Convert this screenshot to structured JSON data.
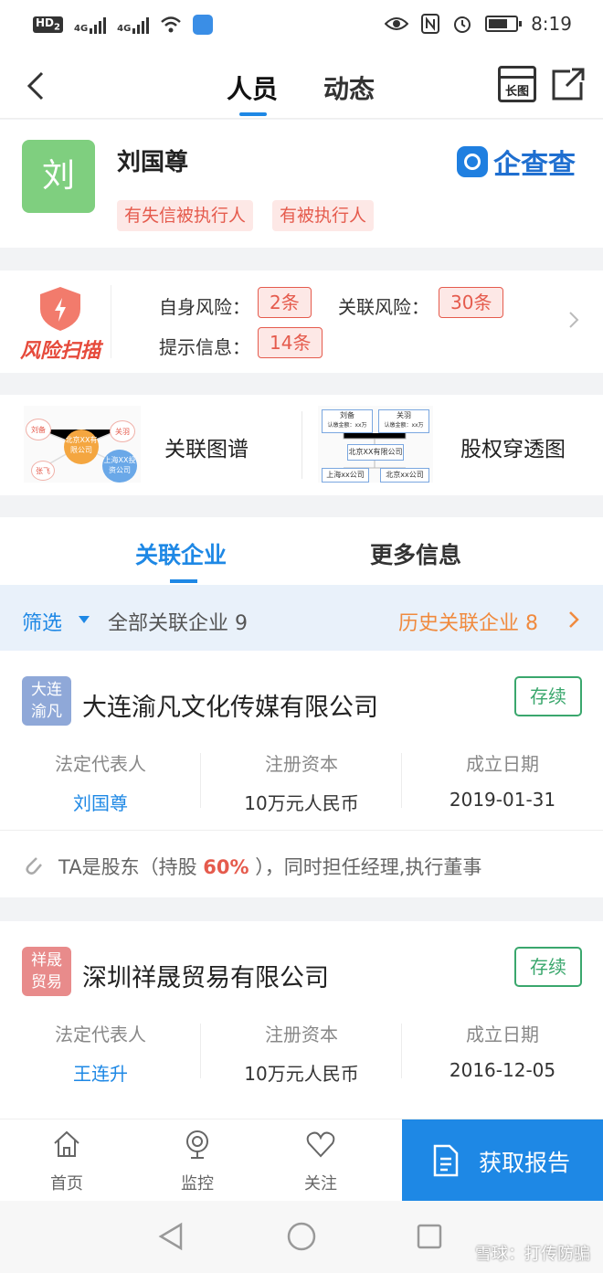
{
  "status_bar": {
    "hd": "HD",
    "hd_sub": "2",
    "net1": "4G",
    "net2": "4G",
    "time": "8:19"
  },
  "header": {
    "tabs": [
      "人员",
      "动态"
    ],
    "long_image": "长图"
  },
  "person": {
    "avatar_char": "刘",
    "name": "刘国尊",
    "tags": [
      "有失信被执行人",
      "有被执行人"
    ],
    "brand": "企查查"
  },
  "risk": {
    "icon_label": "风险扫描",
    "items": [
      {
        "label": "自身风险：",
        "value": "2条"
      },
      {
        "label": "关联风险：",
        "value": "30条"
      },
      {
        "label": "提示信息：",
        "value": "14条"
      }
    ]
  },
  "graphs": {
    "relation": {
      "label": "关联图谱",
      "nodes": [
        "刘备",
        "关羽",
        "张飞",
        "北京XX有限公司",
        "上海XX投资公司"
      ]
    },
    "equity": {
      "label": "股权穿透图",
      "boxes": [
        "刘备",
        "认缴金额：xx万",
        "关羽",
        "认缴金额：xx万",
        "北京XX有限公司",
        "上海xx公司",
        "北京xx公司"
      ]
    }
  },
  "section_tabs": [
    "关联企业",
    "更多信息"
  ],
  "filter": {
    "select": "筛选",
    "all": "全部关联企业 9",
    "history": "历史关联企业 8"
  },
  "companies": [
    {
      "badge": [
        "大连",
        "渝凡"
      ],
      "badge_color": "#8fa8d8",
      "name": "大连渝凡文化传媒有限公司",
      "status": "存续",
      "cols": [
        {
          "label": "法定代表人",
          "value": "刘国尊"
        },
        {
          "label": "注册资本",
          "value": "10万元人民币"
        },
        {
          "label": "成立日期",
          "value": "2019-01-31"
        }
      ],
      "foot": {
        "pre": "TA是股东（持股 ",
        "pct": "60%",
        "post": " ），同时担任经理,执行董事"
      }
    },
    {
      "badge": [
        "祥晟",
        "贸易"
      ],
      "badge_color": "#e88b8b",
      "name": "深圳祥晟贸易有限公司",
      "status": "存续",
      "cols": [
        {
          "label": "法定代表人",
          "value": "王连升"
        },
        {
          "label": "注册资本",
          "value": "10万元人民币"
        },
        {
          "label": "成立日期",
          "value": "2016-12-05"
        }
      ]
    }
  ],
  "bottom_nav": {
    "items": [
      "首页",
      "监控",
      "关注"
    ],
    "report": "获取报告"
  },
  "watermark": "雪球：打传防骗",
  "colors": {
    "accent": "#1e88e5",
    "danger": "#e55b4d",
    "success": "#3aa76d",
    "history": "#f08a3e"
  }
}
